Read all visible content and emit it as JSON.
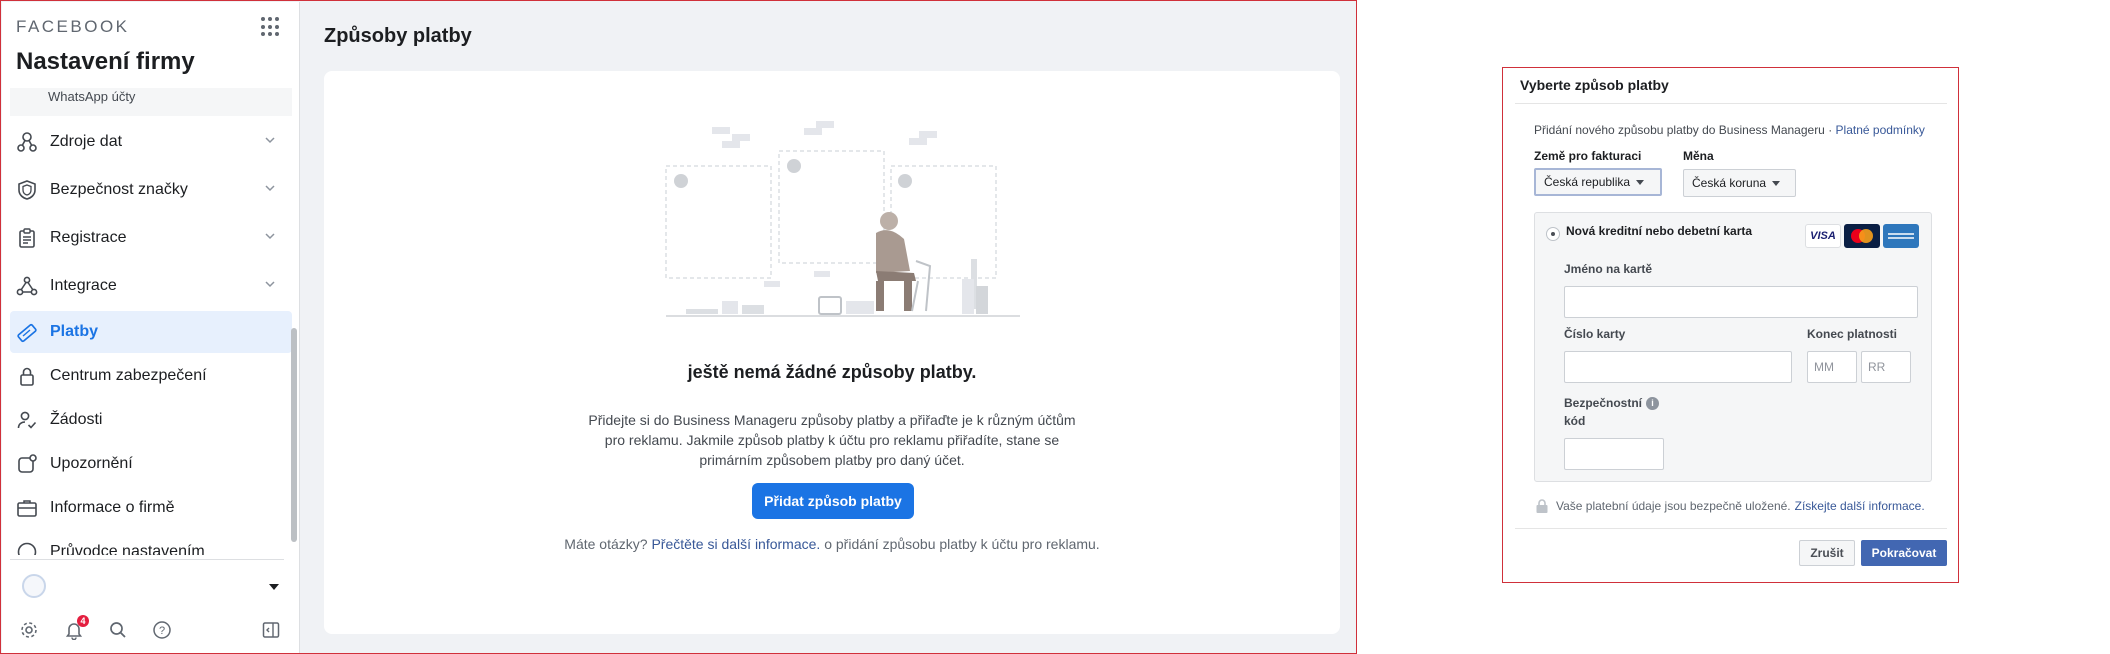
{
  "sidebar": {
    "brand": "FACEBOOK",
    "title": "Nastavení firmy",
    "whatsapp_item": "WhatsApp účty",
    "items": [
      {
        "label": "Zdroje dat",
        "icon": "data-sources-icon",
        "expandable": true
      },
      {
        "label": "Bezpečnost značky",
        "icon": "brand-safety-shield-icon",
        "expandable": true
      },
      {
        "label": "Registrace",
        "icon": "registrations-clipboard-icon",
        "expandable": true
      },
      {
        "label": "Integrace",
        "icon": "integrations-icon",
        "expandable": true
      },
      {
        "label": "Platby",
        "icon": "payments-icon",
        "expandable": false,
        "active": true
      },
      {
        "label": "Centrum zabezpečení",
        "icon": "lock-icon",
        "expandable": false
      },
      {
        "label": "Žádosti",
        "icon": "person-check-icon",
        "expandable": false
      },
      {
        "label": "Upozornění",
        "icon": "notification-icon",
        "expandable": false
      },
      {
        "label": "Informace o firmě",
        "icon": "briefcase-icon",
        "expandable": false
      },
      {
        "label": "Průvodce nastavením",
        "icon": "help-icon",
        "expandable": false
      }
    ],
    "notification_count": "4"
  },
  "main": {
    "page_title": "Způsoby platby",
    "empty_heading": "ještě nemá žádné způsoby platby.",
    "empty_description": "Přidejte si do Business Manageru způsoby platby a přiřaďte je k různým účtům pro reklamu. Jakmile způsob platby k účtu pro reklamu přiřadíte, stane se primárním způsobem platby pro daný účet.",
    "add_button": "Přidat způsob platby",
    "help_prefix": "Máte otázky?",
    "help_link": "Přečtěte si další informace.",
    "help_suffix": "o přidání způsobu platby k účtu pro reklamu."
  },
  "dialog": {
    "title": "Vyberte způsob platby",
    "intro": "Přidání nového způsobu platby do Business Manageru ·",
    "terms_link": "Platné podmínky",
    "country_label": "Země pro fakturaci",
    "country_value": "Česká republika",
    "currency_label": "Měna",
    "currency_value": "Česká koruna",
    "card_option": "Nová kreditní nebo debetní karta",
    "card_brands": [
      "VISA",
      "Mastercard",
      "American Express"
    ],
    "name_label": "Jméno na kartě",
    "number_label": "Číslo karty",
    "expiry_label": "Konec platnosti",
    "expiry_month_placeholder": "MM",
    "expiry_year_placeholder": "RR",
    "security_label_1": "Bezpečnostní",
    "security_label_2": "kód",
    "secure_text": "Vaše platební údaje jsou bezpečně uložené.",
    "secure_link": "Získejte další informace.",
    "cancel_button": "Zrušit",
    "continue_button": "Pokračovat"
  },
  "colors": {
    "accent": "#1b74e4",
    "dialog_primary": "#4267b2",
    "frame_border": "#d0303a",
    "active_bg": "#e7f0fd"
  }
}
